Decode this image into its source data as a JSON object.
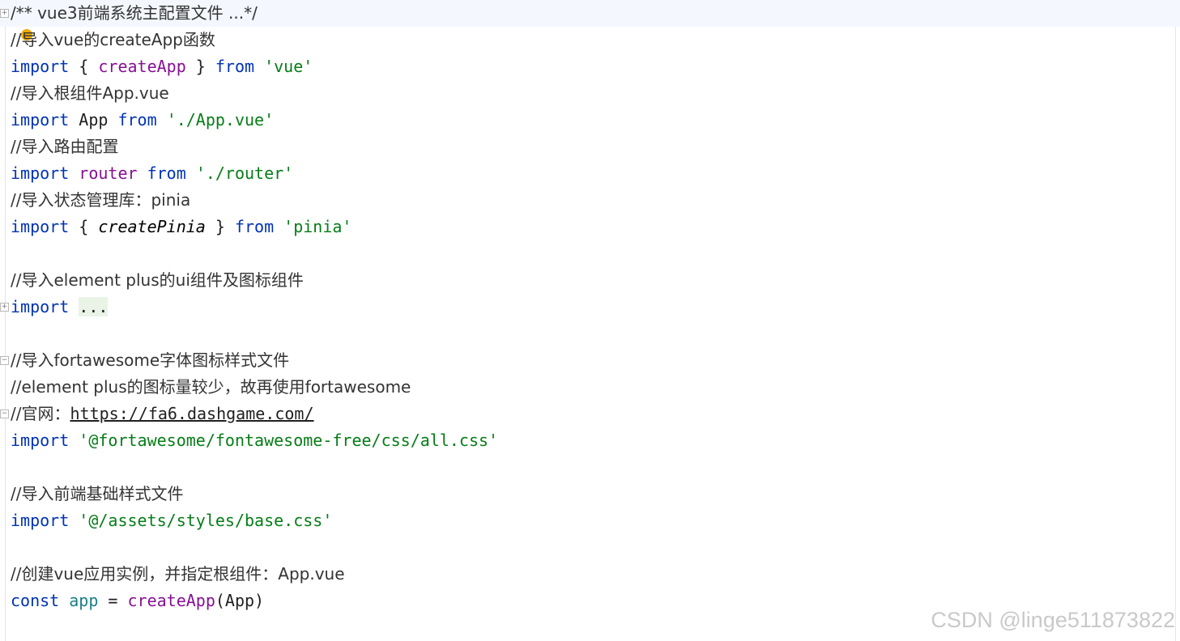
{
  "editor": {
    "lines": [
      {
        "segments": [
          {
            "t": "/** vue3前端系统主配置文件 ...*/",
            "c": "cm"
          }
        ],
        "current": true,
        "fold": "+"
      },
      {
        "segments": [
          {
            "t": "//导入vue的createApp函数",
            "c": "cm"
          }
        ]
      },
      {
        "segments": [
          {
            "t": "import",
            "c": "kw"
          },
          {
            "t": " { "
          },
          {
            "t": "createApp",
            "c": "fn"
          },
          {
            "t": " } "
          },
          {
            "t": "from",
            "c": "kw"
          },
          {
            "t": " "
          },
          {
            "t": "'vue'",
            "c": "str"
          }
        ]
      },
      {
        "segments": [
          {
            "t": "//导入根组件App.vue",
            "c": "cm"
          }
        ]
      },
      {
        "segments": [
          {
            "t": "import",
            "c": "kw"
          },
          {
            "t": " App "
          },
          {
            "t": "from",
            "c": "kw"
          },
          {
            "t": " "
          },
          {
            "t": "'./App.vue'",
            "c": "str"
          }
        ]
      },
      {
        "segments": [
          {
            "t": "//导入路由配置",
            "c": "cm"
          }
        ]
      },
      {
        "segments": [
          {
            "t": "import",
            "c": "kw"
          },
          {
            "t": " "
          },
          {
            "t": "router",
            "c": "fn"
          },
          {
            "t": " "
          },
          {
            "t": "from",
            "c": "kw"
          },
          {
            "t": " "
          },
          {
            "t": "'./router'",
            "c": "str"
          }
        ]
      },
      {
        "segments": [
          {
            "t": "//导入状态管理库：pinia",
            "c": "cm"
          }
        ]
      },
      {
        "segments": [
          {
            "t": "import",
            "c": "kw"
          },
          {
            "t": " { "
          },
          {
            "t": "createPinia",
            "c": "ital"
          },
          {
            "t": " } "
          },
          {
            "t": "from",
            "c": "kw"
          },
          {
            "t": " "
          },
          {
            "t": "'pinia'",
            "c": "str"
          }
        ]
      },
      {
        "segments": []
      },
      {
        "segments": [
          {
            "t": "//导入element plus的ui组件及图标组件",
            "c": "cm"
          }
        ]
      },
      {
        "segments": [
          {
            "t": "import",
            "c": "kw"
          },
          {
            "t": " "
          },
          {
            "t": "...",
            "c": "folded-bg"
          }
        ],
        "fold": "+"
      },
      {
        "segments": []
      },
      {
        "segments": [
          {
            "t": "//导入fortawesome字体图标样式文件",
            "c": "cm"
          }
        ],
        "fold": "-"
      },
      {
        "segments": [
          {
            "t": "//element plus的图标量较少，故再使用fortawesome",
            "c": "cm"
          }
        ]
      },
      {
        "segments": [
          {
            "t": "//官网：",
            "c": "cm"
          },
          {
            "t": "https://fa6.dashgame.com/",
            "c": "link"
          }
        ],
        "fold": "-"
      },
      {
        "segments": [
          {
            "t": "import",
            "c": "kw"
          },
          {
            "t": " "
          },
          {
            "t": "'@fortawesome/fontawesome-free/css/all.css'",
            "c": "str"
          }
        ]
      },
      {
        "segments": []
      },
      {
        "segments": [
          {
            "t": "//导入前端基础样式文件",
            "c": "cm"
          }
        ]
      },
      {
        "segments": [
          {
            "t": "import",
            "c": "kw"
          },
          {
            "t": " "
          },
          {
            "t": "'@/assets/styles/base.css'",
            "c": "str"
          }
        ]
      },
      {
        "segments": []
      },
      {
        "segments": [
          {
            "t": "//创建vue应用实例，并指定根组件：App.vue",
            "c": "cm"
          }
        ]
      },
      {
        "segments": [
          {
            "t": "const",
            "c": "kw"
          },
          {
            "t": " "
          },
          {
            "t": "app",
            "c": "var"
          },
          {
            "t": " = "
          },
          {
            "t": "createApp",
            "c": "fn"
          },
          {
            "t": "(App)"
          }
        ]
      }
    ]
  },
  "watermark": "CSDN @linge511873822",
  "colors": {
    "keyword": "#0033b3",
    "string": "#067d17",
    "function": "#871094",
    "variable": "#1b7e89",
    "marker": "#f0a800"
  }
}
